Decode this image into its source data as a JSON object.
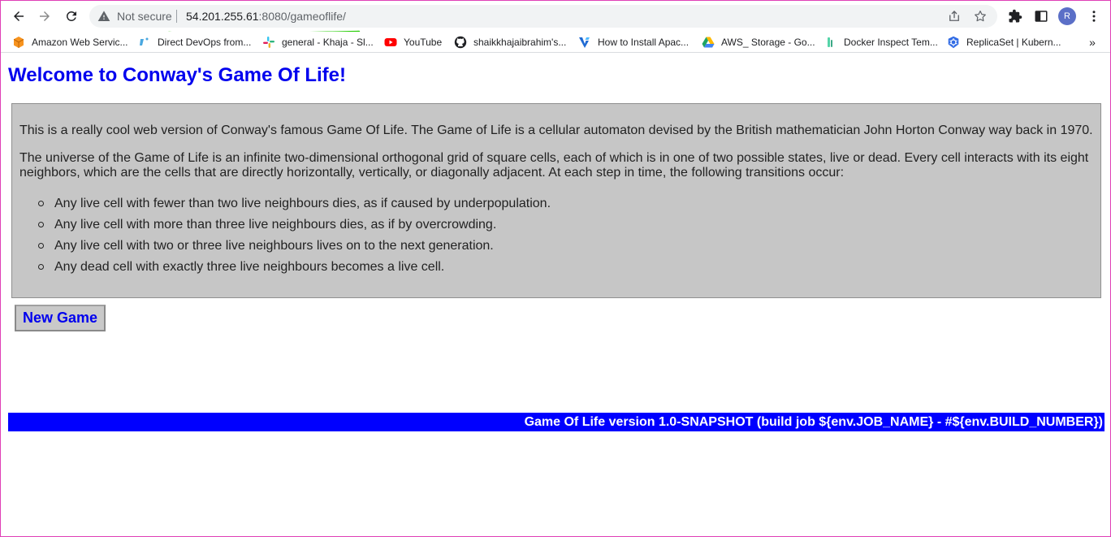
{
  "browser": {
    "security_status": "Not secure",
    "url_host": "54.201.255.61",
    "url_path": ":8080/gameoflife/",
    "profile_initial": "R"
  },
  "bookmarks": [
    {
      "label": "Amazon Web Servic...",
      "icon": "aws-cube-icon",
      "color": "#f7931e"
    },
    {
      "label": "Direct DevOps from...",
      "icon": "devops-icon",
      "color": "#4aa8e0"
    },
    {
      "label": "general - Khaja - Sl...",
      "icon": "slack-icon",
      "color": "#e01e5a"
    },
    {
      "label": "YouTube",
      "icon": "youtube-icon",
      "color": "#ff0000"
    },
    {
      "label": "shaikkhajaibrahim's...",
      "icon": "github-icon",
      "color": "#202124"
    },
    {
      "label": "How to Install Apac...",
      "icon": "vultr-icon",
      "color": "#1f6ad3"
    },
    {
      "label": "AWS_ Storage - Go...",
      "icon": "google-drive-icon",
      "color": "#1fa463"
    },
    {
      "label": "Docker Inspect Tem...",
      "icon": "docker-doc-icon",
      "color": "#55d4a8"
    },
    {
      "label": "ReplicaSet | Kubern...",
      "icon": "kubernetes-icon",
      "color": "#326ce5"
    }
  ],
  "page": {
    "title": "Welcome to Conway's Game Of Life!",
    "intro": "This is a really cool web version of Conway's famous Game Of Life. The Game of Life is a cellular automaton devised by the British mathematician John Horton Conway way back in 1970.",
    "universe": "The universe of the Game of Life is an infinite two-dimensional orthogonal grid of square cells, each of which is in one of two possible states, live or dead. Every cell interacts with its eight neighbors, which are the cells that are directly horizontally, vertically, or diagonally adjacent. At each step in time, the following transitions occur:",
    "rules": [
      "Any live cell with fewer than two live neighbours dies, as if caused by underpopulation.",
      "Any live cell with more than three live neighbours dies, as if by overcrowding.",
      "Any live cell with two or three live neighbours lives on to the next generation.",
      "Any dead cell with exactly three live neighbours becomes a live cell."
    ],
    "new_game_label": "New Game",
    "footer": "Game Of Life version 1.0-SNAPSHOT (build job ${env.JOB_NAME} - #${env.BUILD_NUMBER})"
  },
  "colors": {
    "title": "#0000ee",
    "panel": "#c6c6c6",
    "footer_bg": "#0000ff",
    "annotation": "#22cc00"
  }
}
